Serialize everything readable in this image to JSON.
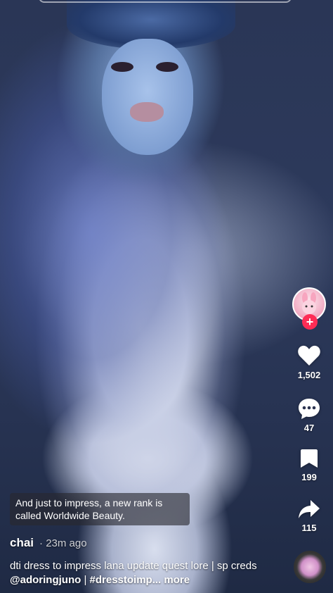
{
  "creator": {
    "avatar_icon": "bunny-avatar-icon",
    "follow_symbol": "+"
  },
  "actions": {
    "likes": "1,502",
    "comments": "47",
    "saves": "199",
    "shares": "115"
  },
  "sticker_text": "And just to impress, a new rank is called Worldwide Beauty.",
  "post": {
    "username": "chai",
    "time": "· 23m ago",
    "caption_start": "dti dress to impress lana update quest lore | sp creds ",
    "mention": "@adoringjuno",
    "separator": " | ",
    "hashtag": "#dresstoimp...",
    "more": " more"
  },
  "colors": {
    "follow_red": "#fe2c55",
    "background": "#2a3656"
  }
}
